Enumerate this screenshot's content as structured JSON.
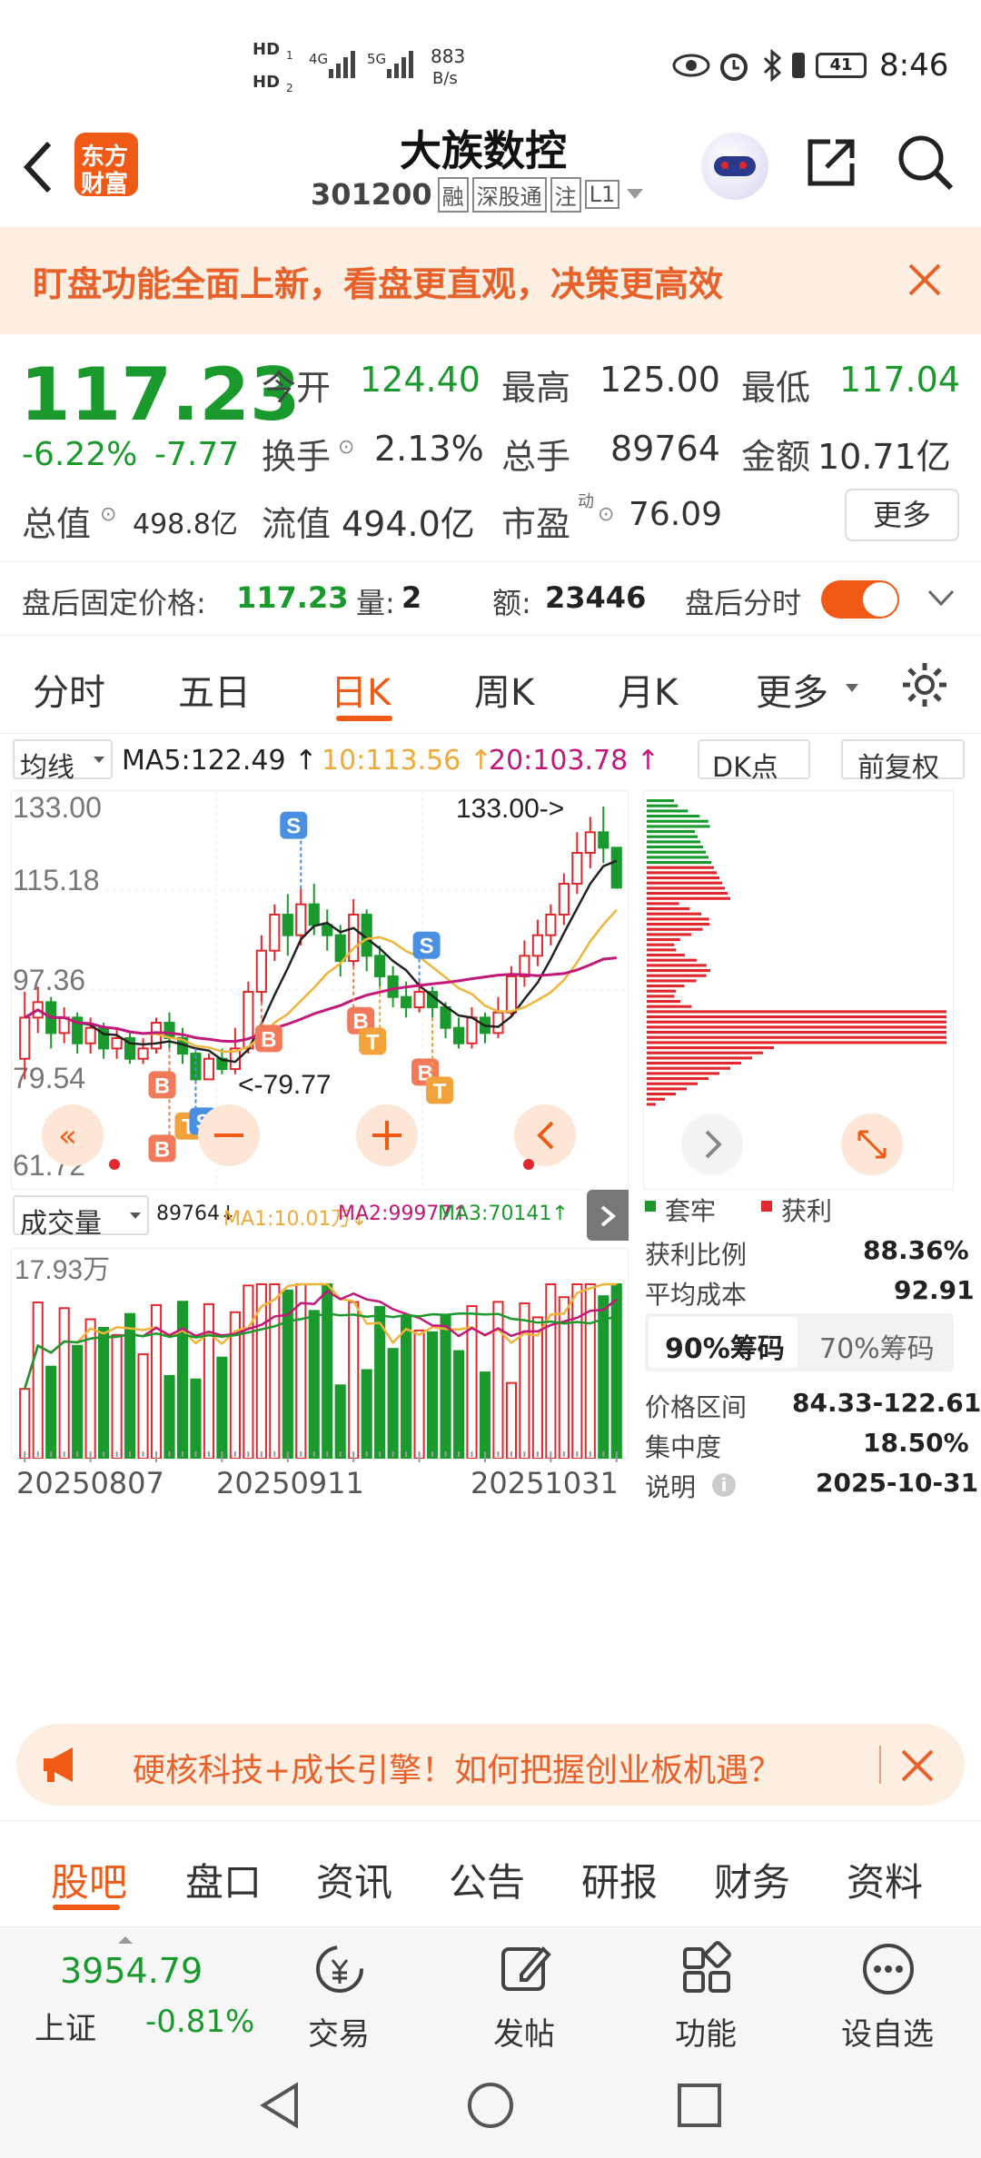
{
  "status": {
    "hd1": "HD",
    "hd1_sub": "1",
    "hd2": "HD",
    "hd2_sub": "2",
    "net1": "4G",
    "net2": "5G",
    "speed_value": "883",
    "speed_unit": "B/s",
    "battery": "41",
    "time": "8:46"
  },
  "nav": {
    "logo_text_line1": "东方",
    "logo_text_line2": "财富",
    "title": "大族数控",
    "code": "301200",
    "tags": [
      "融",
      "深股通",
      "注",
      "L1"
    ]
  },
  "banner": {
    "text": "盯盘功能全面上新，看盘更直观，决策更高效"
  },
  "quote": {
    "price": "117.23",
    "change_pct": "-6.22%",
    "change": "-7.77",
    "open_label": "今开",
    "open": "124.40",
    "high_label": "最高",
    "high": "125.00",
    "low_label": "最低",
    "low": "117.04",
    "turnover_label": "换手",
    "turnover": "2.13%",
    "volume_label": "总手",
    "volume": "89764",
    "amount_label": "金额",
    "amount": "10.71亿",
    "mktcap_label": "总值",
    "mktcap": "498.8亿",
    "float_label": "流值",
    "float": "494.0亿",
    "pe_label": "市盈",
    "pe_sup": "动",
    "pe": "76.09",
    "more_button": "更多"
  },
  "afterhours": {
    "label": "盘后固定价格:",
    "price": "117.23",
    "qty_label": "量:",
    "qty": "2",
    "amt_label": "额:",
    "amt": "23446",
    "toggle_label": "盘后分时"
  },
  "tabs": [
    "分时",
    "五日",
    "日K",
    "周K",
    "月K",
    "更多"
  ],
  "active_tab": "日K",
  "chart_toolbar": {
    "ma_select": "均线",
    "ma5": "MA5:122.49 ↑",
    "ma10": "10:113.56 ↑",
    "ma20": "20:103.78 ↑",
    "dk_select": "DK点",
    "adjust": "前复权"
  },
  "chart_data": {
    "type": "candlestick",
    "y_labels": [
      "133.00",
      "115.18",
      "97.36",
      "79.54",
      "61.72"
    ],
    "annotations": [
      "133.00->",
      "<-79.77"
    ],
    "ylim": [
      61.72,
      133.0
    ],
    "candles": [
      {
        "o": 84,
        "c": 92,
        "h": 97,
        "l": 80
      },
      {
        "o": 92,
        "c": 95,
        "h": 98,
        "l": 89
      },
      {
        "o": 95,
        "c": 89,
        "h": 96,
        "l": 86
      },
      {
        "o": 89,
        "c": 92,
        "h": 94,
        "l": 87
      },
      {
        "o": 92,
        "c": 87,
        "h": 93,
        "l": 85
      },
      {
        "o": 87,
        "c": 90,
        "h": 92,
        "l": 85
      },
      {
        "o": 90,
        "c": 86,
        "h": 91,
        "l": 84
      },
      {
        "o": 86,
        "c": 88,
        "h": 90,
        "l": 84
      },
      {
        "o": 88,
        "c": 84,
        "h": 89,
        "l": 83
      },
      {
        "o": 84,
        "c": 86,
        "h": 88,
        "l": 83
      },
      {
        "o": 86,
        "c": 91,
        "h": 92,
        "l": 85
      },
      {
        "o": 91,
        "c": 88,
        "h": 93,
        "l": 86
      },
      {
        "o": 88,
        "c": 85,
        "h": 90,
        "l": 83
      },
      {
        "o": 85,
        "c": 80,
        "h": 86,
        "l": 79.77
      },
      {
        "o": 80,
        "c": 84,
        "h": 85,
        "l": 80
      },
      {
        "o": 84,
        "c": 82,
        "h": 86,
        "l": 81
      },
      {
        "o": 82,
        "c": 86,
        "h": 90,
        "l": 81
      },
      {
        "o": 86,
        "c": 97,
        "h": 99,
        "l": 85
      },
      {
        "o": 97,
        "c": 105,
        "h": 108,
        "l": 95
      },
      {
        "o": 105,
        "c": 112,
        "h": 114,
        "l": 103
      },
      {
        "o": 112,
        "c": 108,
        "h": 116,
        "l": 104
      },
      {
        "o": 108,
        "c": 114,
        "h": 117,
        "l": 106
      },
      {
        "o": 114,
        "c": 110,
        "h": 118,
        "l": 108
      },
      {
        "o": 110,
        "c": 108,
        "h": 113,
        "l": 105
      },
      {
        "o": 108,
        "c": 103,
        "h": 110,
        "l": 100
      },
      {
        "o": 103,
        "c": 112,
        "h": 115,
        "l": 102
      },
      {
        "o": 112,
        "c": 104,
        "h": 113,
        "l": 101
      },
      {
        "o": 104,
        "c": 100,
        "h": 106,
        "l": 98
      },
      {
        "o": 100,
        "c": 96,
        "h": 102,
        "l": 94
      },
      {
        "o": 96,
        "c": 94,
        "h": 99,
        "l": 92
      },
      {
        "o": 94,
        "c": 97,
        "h": 99,
        "l": 93
      },
      {
        "o": 97,
        "c": 94,
        "h": 98,
        "l": 92
      },
      {
        "o": 94,
        "c": 90,
        "h": 95,
        "l": 88
      },
      {
        "o": 90,
        "c": 87,
        "h": 92,
        "l": 86
      },
      {
        "o": 87,
        "c": 92,
        "h": 94,
        "l": 86
      },
      {
        "o": 92,
        "c": 89,
        "h": 93,
        "l": 87
      },
      {
        "o": 89,
        "c": 93,
        "h": 96,
        "l": 88
      },
      {
        "o": 93,
        "c": 100,
        "h": 102,
        "l": 92
      },
      {
        "o": 100,
        "c": 104,
        "h": 107,
        "l": 98
      },
      {
        "o": 104,
        "c": 108,
        "h": 111,
        "l": 102
      },
      {
        "o": 108,
        "c": 112,
        "h": 114,
        "l": 106
      },
      {
        "o": 112,
        "c": 118,
        "h": 120,
        "l": 110
      },
      {
        "o": 118,
        "c": 124,
        "h": 128,
        "l": 116
      },
      {
        "o": 124,
        "c": 128,
        "h": 131,
        "l": 121
      },
      {
        "o": 128,
        "c": 125,
        "h": 133,
        "l": 122
      },
      {
        "o": 125,
        "c": 117.23,
        "h": 125,
        "l": 117.04
      }
    ],
    "signals": [
      "S",
      "B",
      "T",
      "S",
      "B",
      "B",
      "T",
      "S",
      "B",
      "T",
      "B"
    ],
    "volume_label": "成交量",
    "volume_values": "89764↓",
    "vol_ma1": "MA1:10.01万↓",
    "vol_ma2": "MA2:99977↑",
    "vol_ma3": "MA3:70141↑",
    "vol_max_label": "17.93万",
    "x_labels": [
      "20250807",
      "20250911",
      "20251031"
    ]
  },
  "distribution": {
    "legend_trapped": "套牢",
    "legend_profit": "获利",
    "profit_ratio_label": "获利比例",
    "profit_ratio": "88.36%",
    "avg_cost_label": "平均成本",
    "avg_cost": "92.91",
    "tab90": "90%筹码",
    "tab70": "70%筹码",
    "range_label": "价格区间",
    "range": "84.33-122.61",
    "conc_label": "集中度",
    "conc": "18.50%",
    "note_label": "说明",
    "note_date": "2025-10-31"
  },
  "ad": {
    "text": "硬核科技+成长引擎！如何把握创业板机遇？"
  },
  "subtabs": [
    "股吧",
    "盘口",
    "资讯",
    "公告",
    "研报",
    "财务",
    "资料"
  ],
  "index": {
    "value": "3954.79",
    "name": "上证",
    "change": "-0.81%"
  },
  "bottom_nav": [
    "交易",
    "发帖",
    "功能",
    "设自选"
  ],
  "colors": {
    "up": "#e0282e",
    "down": "#1a9a2c",
    "accent": "#f05a14"
  }
}
